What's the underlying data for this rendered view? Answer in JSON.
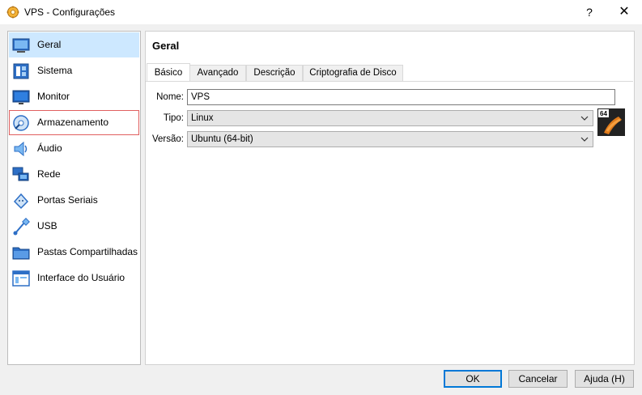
{
  "window": {
    "title": "VPS - Configurações",
    "help_glyph": "?",
    "close_glyph": "✕"
  },
  "sidebar": {
    "items": [
      {
        "label": "Geral",
        "icon": "general-icon"
      },
      {
        "label": "Sistema",
        "icon": "system-icon"
      },
      {
        "label": "Monitor",
        "icon": "monitor-icon"
      },
      {
        "label": "Armazenamento",
        "icon": "storage-icon"
      },
      {
        "label": "Áudio",
        "icon": "audio-icon"
      },
      {
        "label": "Rede",
        "icon": "network-icon"
      },
      {
        "label": "Portas Seriais",
        "icon": "serial-ports-icon"
      },
      {
        "label": "USB",
        "icon": "usb-icon"
      },
      {
        "label": "Pastas Compartilhadas",
        "icon": "shared-folders-icon"
      },
      {
        "label": "Interface do Usuário",
        "icon": "user-interface-icon"
      }
    ],
    "selected": "Geral",
    "highlighted": "Armazenamento"
  },
  "main": {
    "section_title": "Geral",
    "tabs": [
      {
        "label": "Básico"
      },
      {
        "label": "Avançado"
      },
      {
        "label": "Descrição"
      },
      {
        "label": "Criptografia de Disco"
      }
    ],
    "active_tab": "Básico",
    "fields": {
      "name_label": "Nome:",
      "name_value": "VPS",
      "type_label": "Tipo:",
      "type_value": "Linux",
      "version_label": "Versão:",
      "version_value": "Ubuntu (64-bit)"
    },
    "os_badge": "64"
  },
  "footer": {
    "ok_label": "OK",
    "cancel_label": "Cancelar",
    "help_label": "Ajuda (H)"
  },
  "colors": {
    "selected_bg": "#cde8ff",
    "highlight_border": "#e06060",
    "ok_border": "#0078d7"
  }
}
